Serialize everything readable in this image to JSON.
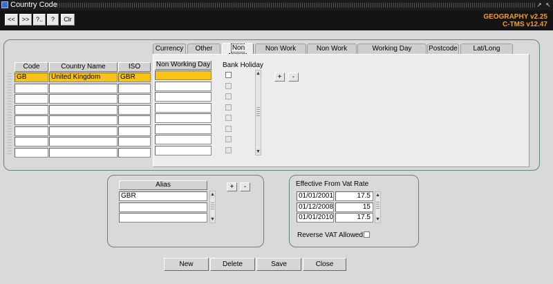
{
  "window": {
    "title": "Country Code",
    "controls": [
      "↗",
      "↖"
    ]
  },
  "toolbar": {
    "buttons": [
      "<<",
      ">>",
      "?..",
      "?",
      "Clr"
    ]
  },
  "app_info": {
    "line1": "GEOGRAPHY v2.25",
    "line2": "C-TMS v12.47"
  },
  "country_table": {
    "headers": [
      "Code",
      "Country Name",
      "ISO"
    ],
    "rows": [
      [
        "GB",
        "United Kingdom",
        "GBR"
      ],
      [
        "",
        "",
        ""
      ],
      [
        "",
        "",
        ""
      ],
      [
        "",
        "",
        ""
      ],
      [
        "",
        "",
        ""
      ],
      [
        "",
        "",
        ""
      ],
      [
        "",
        "",
        ""
      ],
      [
        "",
        "",
        ""
      ]
    ],
    "selected_row": 0
  },
  "tabs": [
    "Currency",
    "Other",
    "Non Work",
    "Non Work Depot",
    "Non Work Route",
    "Working Day Exception",
    "Postcode",
    "Lat/Long Request"
  ],
  "active_tab": "Non Work",
  "non_work": {
    "header_day": "Non Working Day",
    "header_holiday": "Bank Holiday",
    "rows": 8,
    "add_label": "+",
    "remove_label": "-"
  },
  "alias": {
    "header": "Alias",
    "values": [
      "GBR",
      "",
      ""
    ],
    "add_label": "+",
    "remove_label": "-"
  },
  "vat": {
    "header_date": "Effective From",
    "header_rate": "Vat Rate",
    "rows": [
      {
        "date": "01/01/2001",
        "rate": "17.5"
      },
      {
        "date": "01/12/2008",
        "rate": "15"
      },
      {
        "date": "01/01/2010",
        "rate": "17.5"
      }
    ],
    "reverse_label": "Reverse VAT Allowed",
    "reverse_checked": false
  },
  "actions": {
    "new": "New",
    "delete": "Delete",
    "save": "Save",
    "close": "Close"
  }
}
